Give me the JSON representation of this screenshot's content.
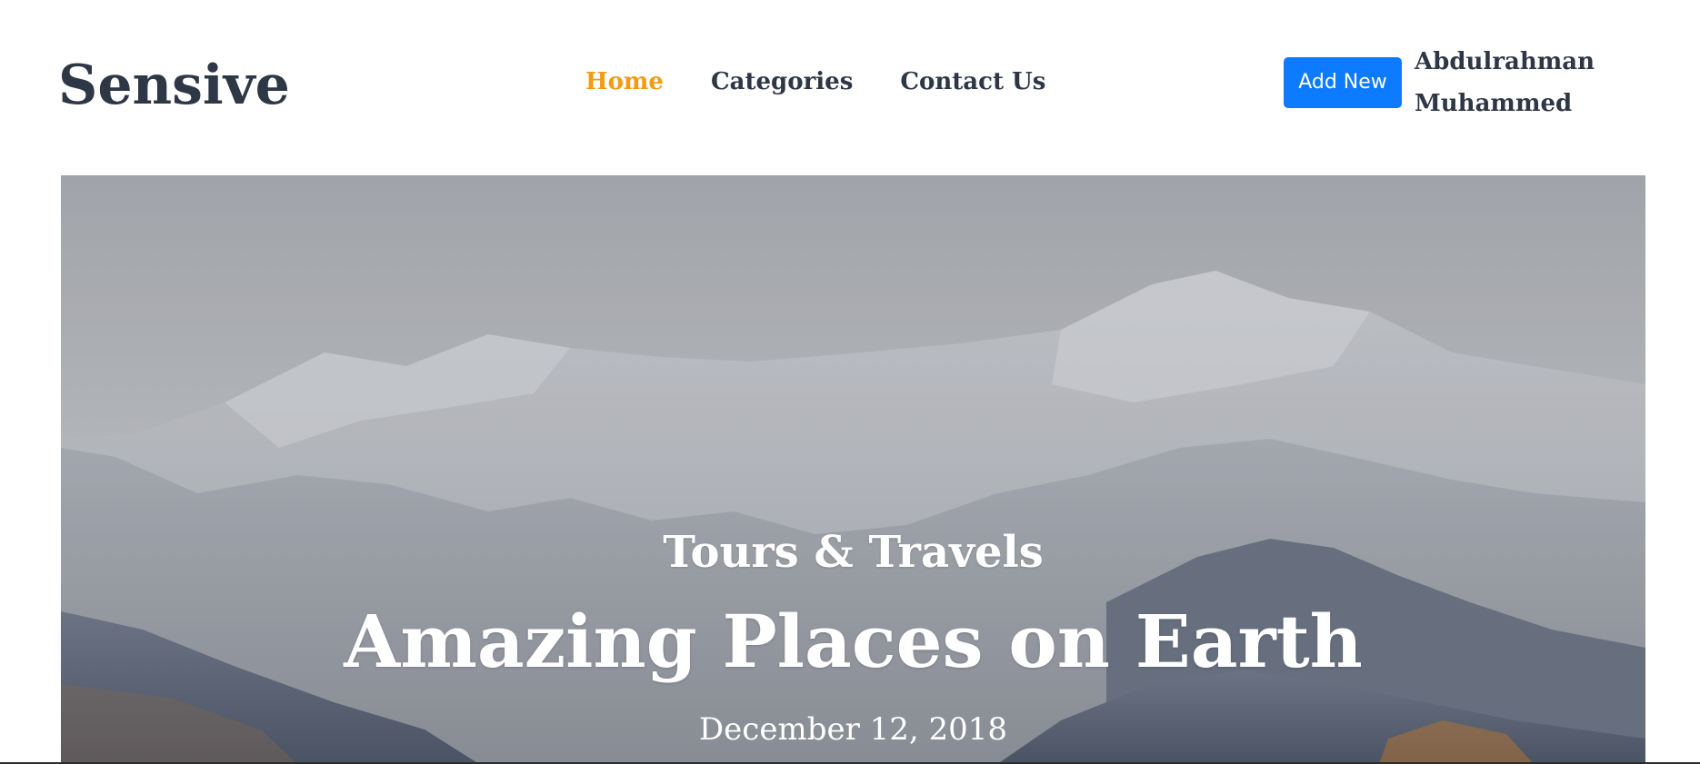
{
  "header": {
    "logo": "Sensive",
    "nav": [
      {
        "label": "Home",
        "active": true
      },
      {
        "label": "Categories",
        "active": false
      },
      {
        "label": "Contact Us",
        "active": false
      }
    ],
    "add_button_label": "Add New",
    "user": {
      "first_name": "Abdulrahman",
      "last_name": "Muhammed"
    }
  },
  "hero": {
    "category": "Tours & Travels",
    "title": "Amazing Places on Earth",
    "date": "December 12, 2018",
    "image_subject": "snow-capped mountains"
  },
  "colors": {
    "text_dark": "#2e3746",
    "accent": "#f29b14",
    "button": "#0d7bff"
  }
}
